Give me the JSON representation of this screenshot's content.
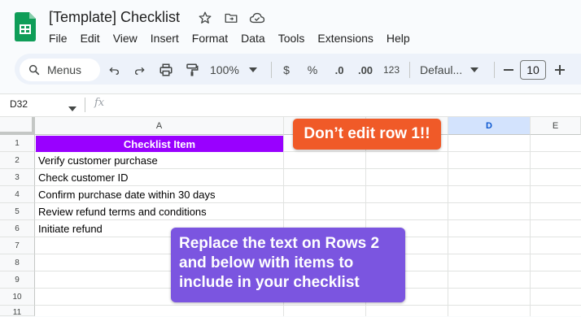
{
  "app": {
    "doc_title": "[Template] Checklist",
    "title_icons": [
      "star-icon",
      "move-to-folder-icon",
      "cloud-status-icon"
    ]
  },
  "menu": [
    "File",
    "Edit",
    "View",
    "Insert",
    "Format",
    "Data",
    "Tools",
    "Extensions",
    "Help"
  ],
  "toolbar": {
    "search_label": "Menus",
    "zoom": "100%",
    "currency": "$",
    "percent": "%",
    "decrease_decimals": ".0",
    "increase_decimals": ".00",
    "number_format": "123",
    "font_name": "Defaul...",
    "font_size": "10"
  },
  "formula_bar": {
    "cell_ref": "D32",
    "fx": "fx"
  },
  "columns": [
    "A",
    "B",
    "C",
    "D",
    "E"
  ],
  "selected_column": "D",
  "rows": [
    "1",
    "2",
    "3",
    "4",
    "5",
    "6",
    "7",
    "8",
    "9",
    "10",
    "11"
  ],
  "cells": {
    "header": "Checklist Item",
    "items": [
      "Verify customer purchase",
      "Check customer ID",
      "Confirm purchase date within 30 days",
      "Review refund terms and conditions",
      "Initiate refund"
    ]
  },
  "callouts": {
    "row1_warning": "Don’t edit row 1!!",
    "instructions": "Replace the text on Rows 2 and below with items to include in your checklist"
  },
  "colors": {
    "header_fill": "#9900ff",
    "warning_fill": "#f05a28",
    "instruction_fill": "#7b55e0",
    "sheets_green": "#0f9d58"
  }
}
